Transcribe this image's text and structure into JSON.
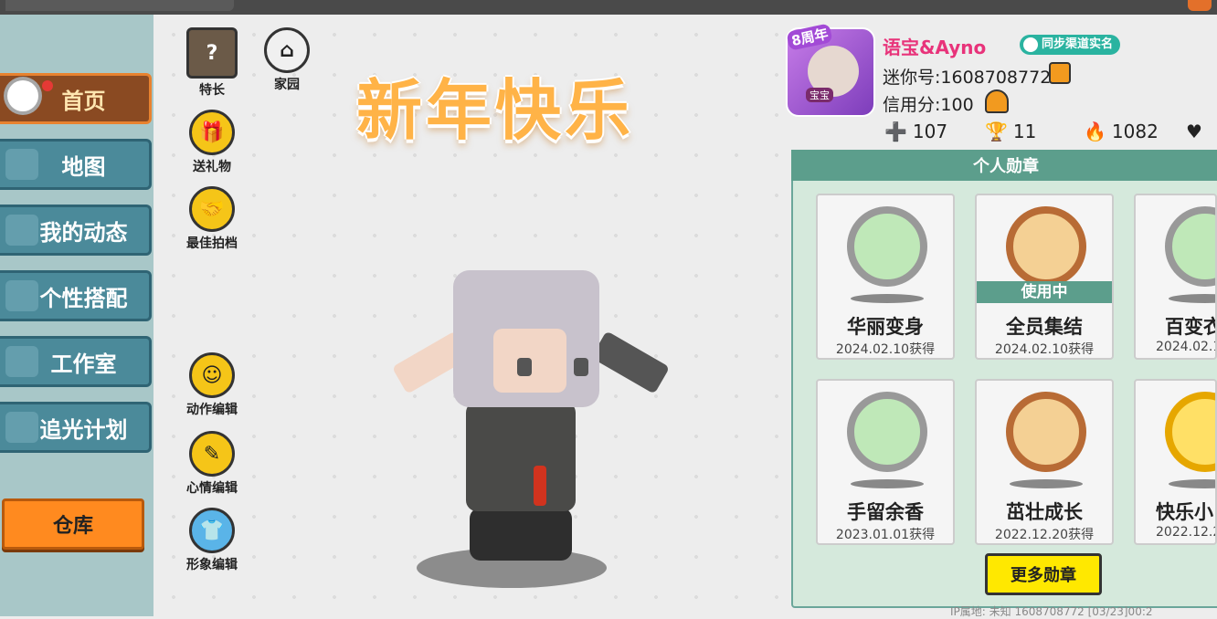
{
  "sidebar": {
    "items": [
      {
        "label": "首页",
        "icon": "home-icon"
      },
      {
        "label": "地图",
        "icon": "map-icon"
      },
      {
        "label": "我的动态",
        "icon": "bell-icon"
      },
      {
        "label": "个性搭配",
        "icon": "outfit-icon"
      },
      {
        "label": "工作室",
        "icon": "studio-icon"
      },
      {
        "label": "追光计划",
        "icon": "spotlight-icon"
      }
    ],
    "warehouse_label": "仓库"
  },
  "center": {
    "banner": "新年快乐",
    "tools": [
      {
        "label": "特长",
        "icon": "question-icon"
      },
      {
        "label": "家园",
        "icon": "house-icon"
      },
      {
        "label": "送礼物",
        "icon": "gift-icon"
      },
      {
        "label": "最佳拍档",
        "icon": "handshake-icon"
      },
      {
        "label": "动作编辑",
        "icon": "action-icon"
      },
      {
        "label": "心情编辑",
        "icon": "edit-icon"
      },
      {
        "label": "形象编辑",
        "icon": "shirt-icon"
      }
    ]
  },
  "profile": {
    "anniversary_badge": "8周年",
    "avatar_caption": "宝宝",
    "nickname": "语宝&Ayno",
    "realname_badge": "同步渠道实名",
    "uid": "迷你号:1608708772",
    "credit": "信用分:100",
    "stats": [
      {
        "icon": "plus-icon",
        "value": "107"
      },
      {
        "icon": "trophy-icon",
        "value": "11"
      },
      {
        "icon": "fire-icon",
        "value": "1082"
      },
      {
        "icon": "heart-icon",
        "value": ""
      }
    ]
  },
  "medals": {
    "title": "个人勋章",
    "items": [
      {
        "name": "华丽变身",
        "date": "2024.02.10获得",
        "in_use": false
      },
      {
        "name": "全员集结",
        "date": "2024.02.10获得",
        "in_use": true,
        "in_use_label": "使用中"
      },
      {
        "name": "百变衣",
        "date": "2024.02.1",
        "in_use": false
      },
      {
        "name": "手留余香",
        "date": "2023.01.01获得",
        "in_use": false
      },
      {
        "name": "茁壮成长",
        "date": "2022.12.20获得",
        "in_use": false
      },
      {
        "name": "快乐小",
        "date": "2022.12.2",
        "in_use": false
      }
    ],
    "more_label": "更多勋章"
  },
  "footer": "IP属地: 未知        1608708772    [03/23]00:2"
}
